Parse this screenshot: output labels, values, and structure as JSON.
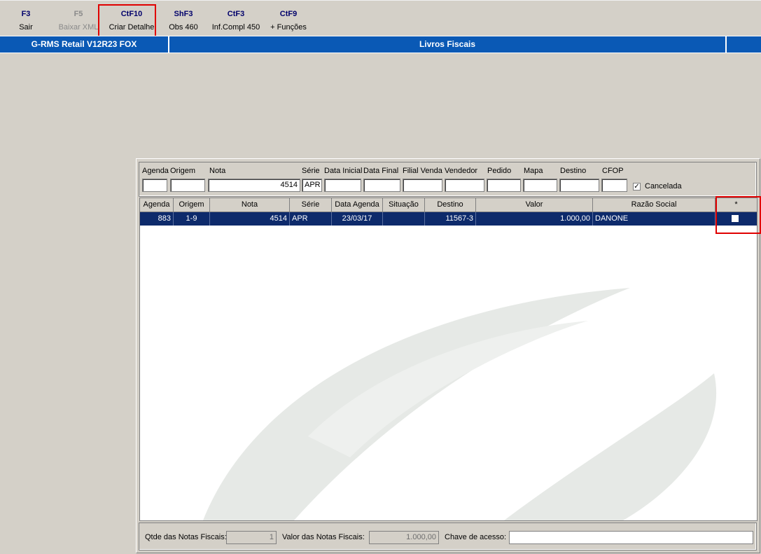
{
  "toolbar": {
    "keys": [
      {
        "key": "F3",
        "label": "Sair",
        "enabled": true
      },
      {
        "key": "F5",
        "label": "Baixar XML",
        "enabled": false
      },
      {
        "key": "CtF10",
        "label": "Criar Detalhe",
        "enabled": true,
        "highlighted": true
      },
      {
        "key": "ShF3",
        "label": "Obs 460",
        "enabled": true
      },
      {
        "key": "CtF3",
        "label": "Inf.Compl 450",
        "enabled": true
      },
      {
        "key": "CtF9",
        "label": "+ Funções",
        "enabled": true
      }
    ]
  },
  "titlebar": {
    "app_name": "G-RMS Retail V12R23 FOX",
    "screen_title": "Livros Fiscais"
  },
  "filters": {
    "labels": {
      "agenda": "Agenda",
      "origem": "Origem",
      "nota": "Nota",
      "serie": "Série",
      "data_inicial": "Data Inicial",
      "data_final": "Data Final",
      "filial_venda": "Filial Venda",
      "vendedor": "Vendedor",
      "pedido": "Pedido",
      "mapa": "Mapa",
      "destino": "Destino",
      "cfop": "CFOP",
      "cancelada": "Cancelada"
    },
    "values": {
      "agenda": "",
      "origem": "",
      "nota": "4514",
      "serie": "APR",
      "data_inicial": "",
      "data_final": "",
      "filial_venda": "",
      "vendedor": "",
      "pedido": "",
      "mapa": "",
      "destino": "",
      "cfop": "",
      "cancelada_checked": true
    }
  },
  "grid": {
    "columns": [
      "Agenda",
      "Origem",
      "Nota",
      "Série",
      "Data Agenda",
      "Situação",
      "Destino",
      "Valor",
      "Razão Social",
      "*"
    ],
    "rows": [
      {
        "agenda": "883",
        "origem": "1-9",
        "nota": "4514",
        "serie": "APR",
        "data_agenda": "23/03/17",
        "situacao": "",
        "destino": "11567-3",
        "valor": "1.000,00",
        "razao_social": "DANONE",
        "selected": false
      }
    ]
  },
  "footer": {
    "qtde_label": "Qtde das Notas Fiscais:",
    "qtde_value": "1",
    "valor_label": "Valor  das Notas Fiscais:",
    "valor_value": "1.000,00",
    "chave_label": "Chave de acesso:",
    "chave_value": ""
  },
  "colors": {
    "window_bg": "#d4d0c8",
    "titlebar_bg": "#0a59b5",
    "selected_row_bg": "#0d2a6b",
    "highlight_box": "#e00000",
    "fkey_text": "#00006b"
  }
}
